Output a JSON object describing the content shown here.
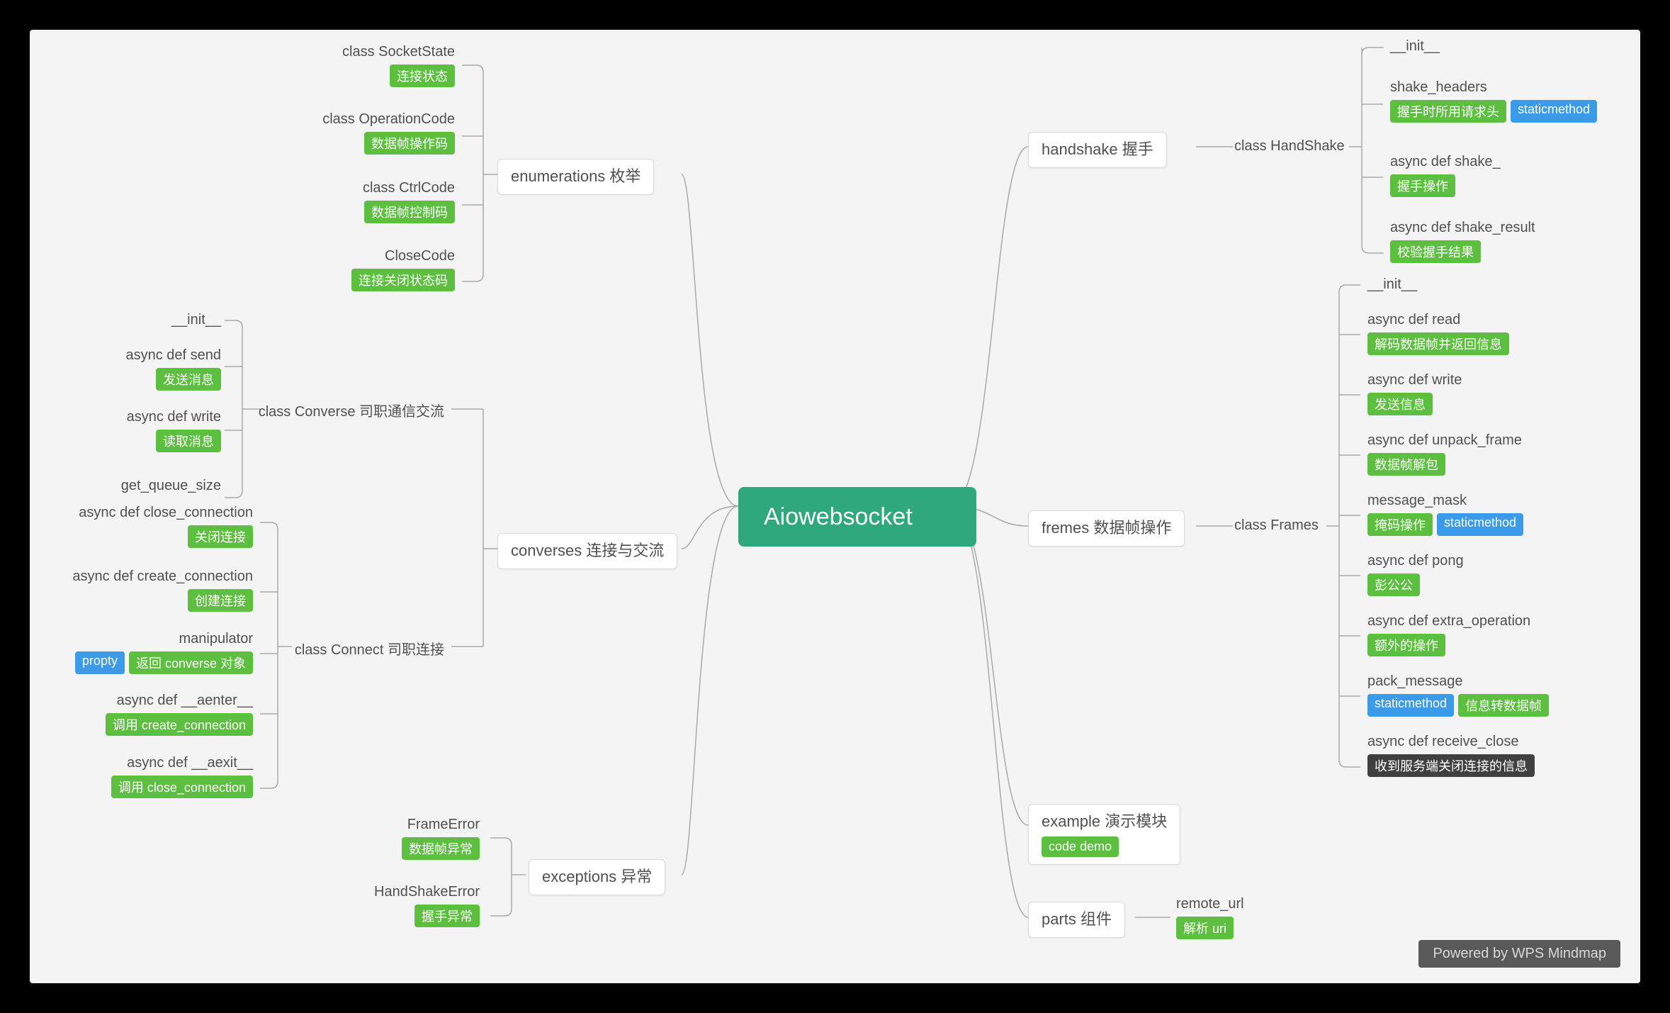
{
  "root": {
    "title": "Aiowebsocket"
  },
  "watermark": "Powered by WPS Mindmap",
  "right": {
    "handshake": {
      "title": "handshake 握手",
      "child": "class HandShake",
      "items": [
        {
          "title": "__init__"
        },
        {
          "title": "shake_headers",
          "tags": [
            {
              "text": "握手时所用请求头",
              "style": "green"
            },
            {
              "text": "staticmethod",
              "style": "blue"
            }
          ]
        },
        {
          "title": "async def shake_",
          "tags": [
            {
              "text": "握手操作",
              "style": "green"
            }
          ]
        },
        {
          "title": "async def shake_result",
          "tags": [
            {
              "text": "校验握手结果",
              "style": "green"
            }
          ]
        }
      ]
    },
    "frames": {
      "title": "fremes 数据帧操作",
      "child": "class Frames",
      "items": [
        {
          "title": "__init__"
        },
        {
          "title": "async def read",
          "tags": [
            {
              "text": "解码数据帧并返回信息",
              "style": "green"
            }
          ]
        },
        {
          "title": "async def write",
          "tags": [
            {
              "text": "发送信息",
              "style": "green"
            }
          ]
        },
        {
          "title": "async def unpack_frame",
          "tags": [
            {
              "text": "数据帧解包",
              "style": "green"
            }
          ]
        },
        {
          "title": "message_mask",
          "tags": [
            {
              "text": "掩码操作",
              "style": "green"
            },
            {
              "text": "staticmethod",
              "style": "blue"
            }
          ]
        },
        {
          "title": "async def pong",
          "tags": [
            {
              "text": "彭公公",
              "style": "green"
            }
          ]
        },
        {
          "title": "async def extra_operation",
          "tags": [
            {
              "text": "额外的操作",
              "style": "green"
            }
          ]
        },
        {
          "title": "pack_message",
          "tags": [
            {
              "text": "staticmethod",
              "style": "blue"
            },
            {
              "text": "信息转数据帧",
              "style": "green"
            }
          ]
        },
        {
          "title": "async def receive_close",
          "tags": [
            {
              "text": "收到服务端关闭连接的信息",
              "style": "dark"
            }
          ]
        }
      ]
    },
    "example": {
      "title": "example 演示模块",
      "tags": [
        {
          "text": "code demo",
          "style": "green"
        }
      ]
    },
    "parts": {
      "title": "parts 组件",
      "item": {
        "title": "remote_url",
        "tags": [
          {
            "text": "解析 uri",
            "style": "green"
          }
        ]
      }
    }
  },
  "left": {
    "enumerations": {
      "title": "enumerations 枚举",
      "items": [
        {
          "title": "class SocketState",
          "tags": [
            {
              "text": "连接状态",
              "style": "green"
            }
          ]
        },
        {
          "title": "class OperationCode",
          "tags": [
            {
              "text": "数据帧操作码",
              "style": "green"
            }
          ]
        },
        {
          "title": "class CtrlCode",
          "tags": [
            {
              "text": "数据帧控制码",
              "style": "green"
            }
          ]
        },
        {
          "title": "CloseCode",
          "tags": [
            {
              "text": "连接关闭状态码",
              "style": "green"
            }
          ]
        }
      ]
    },
    "converses": {
      "title": "converses 连接与交流",
      "converse": {
        "title": "class Converse 司职通信交流",
        "items": [
          {
            "title": "__init__"
          },
          {
            "title": "async def send",
            "tags": [
              {
                "text": "发送消息",
                "style": "green"
              }
            ]
          },
          {
            "title": "async def write",
            "tags": [
              {
                "text": "读取消息",
                "style": "green"
              }
            ]
          },
          {
            "title": "get_queue_size"
          }
        ]
      },
      "connect": {
        "title": "class Connect 司职连接",
        "items": [
          {
            "title": "async def close_connection",
            "tags": [
              {
                "text": "关闭连接",
                "style": "green"
              }
            ]
          },
          {
            "title": "async def create_connection",
            "tags": [
              {
                "text": "创建连接",
                "style": "green"
              }
            ]
          },
          {
            "title": "manipulator",
            "tags": [
              {
                "text": "propty",
                "style": "blue"
              },
              {
                "text": "返回 converse 对象",
                "style": "green"
              }
            ]
          },
          {
            "title": "async def __aenter__",
            "tags": [
              {
                "text": "调用 create_connection",
                "style": "green"
              }
            ]
          },
          {
            "title": "async def __aexit__",
            "tags": [
              {
                "text": "调用 close_connection",
                "style": "green"
              }
            ]
          }
        ]
      }
    },
    "exceptions": {
      "title": "exceptions 异常",
      "items": [
        {
          "title": "FrameError",
          "tags": [
            {
              "text": "数据帧异常",
              "style": "green"
            }
          ]
        },
        {
          "title": "HandShakeError",
          "tags": [
            {
              "text": "握手异常",
              "style": "green"
            }
          ]
        }
      ]
    }
  }
}
